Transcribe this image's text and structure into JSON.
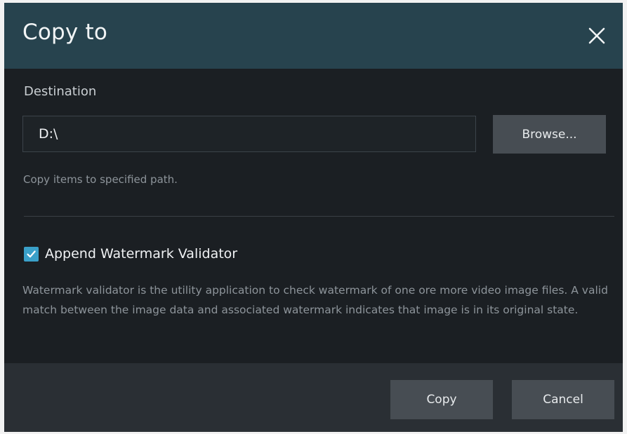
{
  "dialog": {
    "title": "Copy to",
    "close_icon": "close-icon"
  },
  "destination": {
    "label": "Destination",
    "value": "D:\\",
    "browse_label": "Browse...",
    "hint": "Copy items to specified path."
  },
  "watermark": {
    "checked": true,
    "label": "Append Watermark Validator",
    "description": "Watermark validator is the utility application to check watermark of one ore more video image files. A valid match between the image data and associated watermark indicates that image is in its original state."
  },
  "footer": {
    "copy_label": "Copy",
    "cancel_label": "Cancel"
  },
  "colors": {
    "titlebar": "#27434e",
    "body": "#1b1f23",
    "footer": "#2a2f34",
    "button": "#474d53",
    "accent": "#3aa0c9"
  }
}
